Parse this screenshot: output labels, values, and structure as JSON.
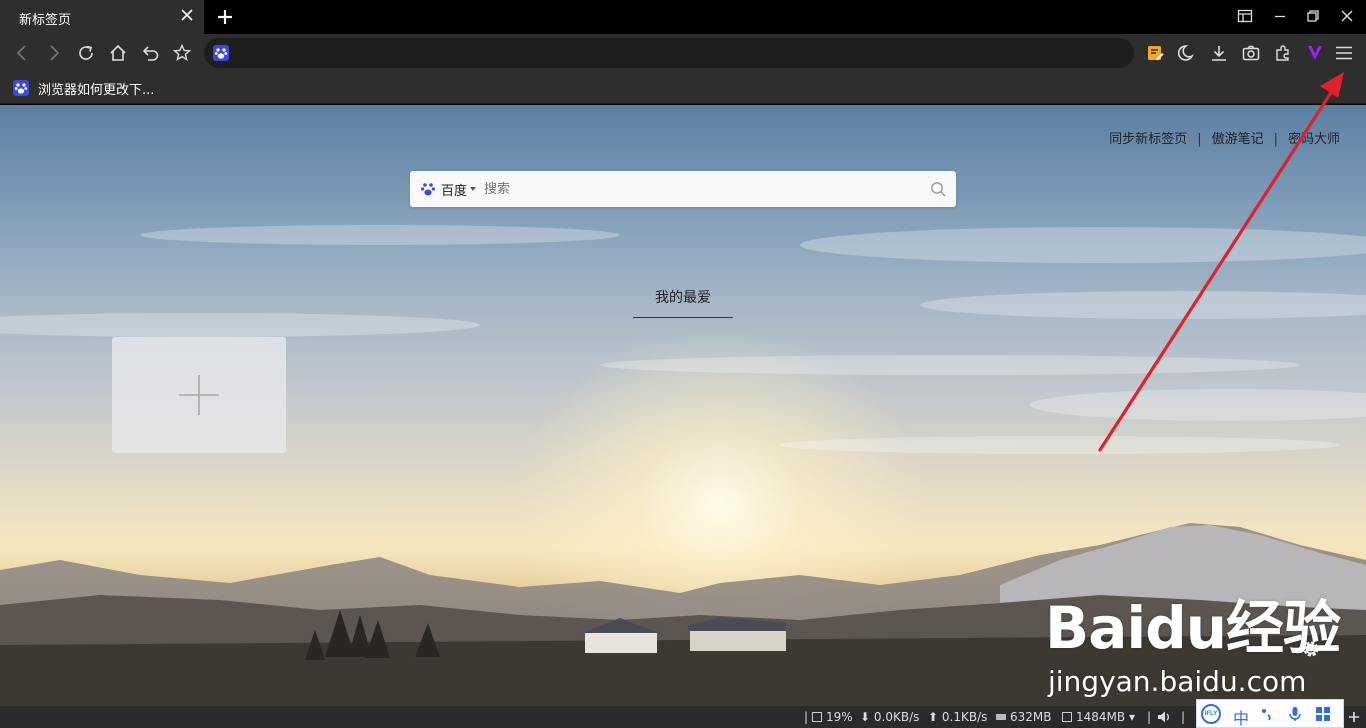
{
  "tab": {
    "title": "新标签页"
  },
  "bookmarks": [
    {
      "label": "浏览器如何更改下..."
    }
  ],
  "header_links": [
    "同步新标签页",
    "傲游笔记",
    "密码大师"
  ],
  "search": {
    "engine": "百度",
    "placeholder": "搜索"
  },
  "favorites": {
    "title": "我的最爱"
  },
  "watermark": {
    "logo": "Baidu经验",
    "url": "jingyan.baidu.com"
  },
  "statusbar": {
    "cpu": "19%",
    "download_speed": "0.0KB/s",
    "upload_speed": "0.1KB/s",
    "memory": "632MB",
    "browser_memory": "1484MB"
  },
  "ime": {
    "mode": "中",
    "brand": "iFLY"
  },
  "colors": {
    "accent_arrow": "#e0202a",
    "favicon": "#3b4bd8",
    "ime_blue": "#2f6fe0"
  }
}
